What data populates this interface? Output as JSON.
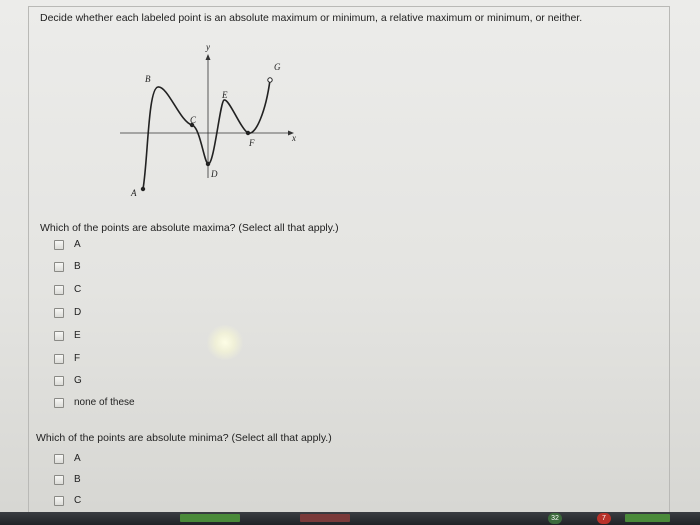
{
  "instructions": "Decide whether each labeled point is an absolute maximum or minimum, a relative maximum or minimum, or neither.",
  "graph": {
    "axis_labels": {
      "x": "x",
      "y": "y"
    },
    "points": [
      "A",
      "B",
      "C",
      "D",
      "E",
      "F",
      "G"
    ]
  },
  "question1": {
    "prompt": "Which of the points are absolute maxima? (Select all that apply.)",
    "options": [
      "A",
      "B",
      "C",
      "D",
      "E",
      "F",
      "G",
      "none of these"
    ]
  },
  "question2": {
    "prompt": "Which of the points are absolute minima? (Select all that apply.)",
    "options": [
      "A",
      "B",
      "C"
    ]
  },
  "taskbar": {
    "badge_left": "32",
    "badge_right": "7"
  }
}
